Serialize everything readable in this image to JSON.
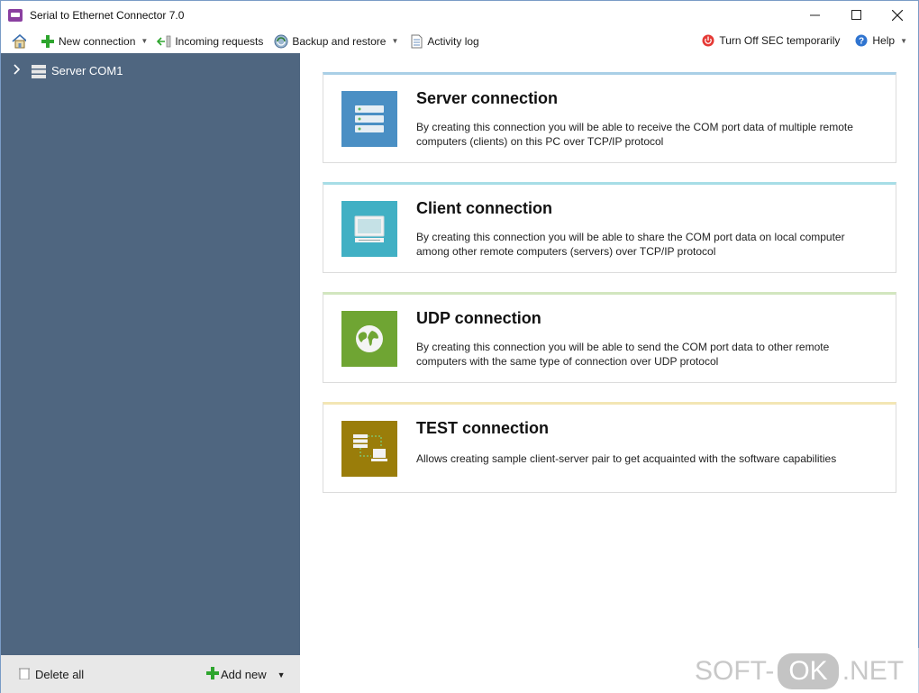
{
  "window": {
    "title": "Serial to Ethernet Connector 7.0"
  },
  "toolbar": {
    "home_icon": "home-icon",
    "new_connection": "New connection",
    "incoming_requests": "Incoming requests",
    "backup_restore": "Backup and restore",
    "activity_log": "Activity log",
    "turn_off": "Turn Off SEC temporarily",
    "help": "Help"
  },
  "sidebar": {
    "items": [
      {
        "label": "Server COM1",
        "icon": "server-icon"
      }
    ],
    "footer": {
      "delete_all": "Delete all",
      "add_new": "Add new"
    }
  },
  "cards": [
    {
      "title": "Server connection",
      "description": "By creating this connection you will be able to receive the COM port data of multiple remote computers (clients) on this PC over TCP/IP protocol",
      "icon": "server-stack-icon",
      "color": "#4a8fc4",
      "accent": "#a9cfe6"
    },
    {
      "title": "Client connection",
      "description": "By creating this connection you will be able to share the COM port data on local computer among other remote computers (servers) over TCP/IP protocol",
      "icon": "monitor-icon",
      "color": "#41b0c4",
      "accent": "#a7dde6"
    },
    {
      "title": "UDP connection",
      "description": "By creating this connection you will be able to send the COM port data to other remote computers with the same type of connection over UDP protocol",
      "icon": "globe-icon",
      "color": "#6fa533",
      "accent": "#d2e6bf"
    },
    {
      "title": "TEST connection",
      "description": "Allows creating sample client-server pair to get acquainted with the software capabilities",
      "icon": "test-pair-icon",
      "color": "#9a7d0a",
      "accent": "#f3e6b4"
    }
  ],
  "watermark": {
    "part1": "SOFT-",
    "part2": "OK",
    "part3": ".NET"
  }
}
